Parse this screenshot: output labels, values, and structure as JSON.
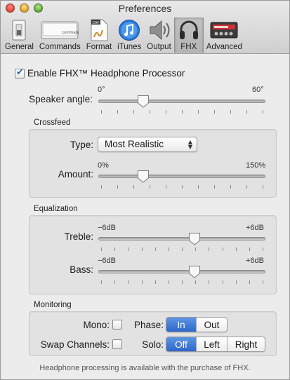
{
  "window": {
    "title": "Preferences"
  },
  "toolbar": {
    "items": [
      {
        "label": "General",
        "icon": "general-switch-icon"
      },
      {
        "label": "Commands",
        "icon": "command-key-icon"
      },
      {
        "label": "Format",
        "icon": "caf-document-icon"
      },
      {
        "label": "iTunes",
        "icon": "itunes-note-icon"
      },
      {
        "label": "Output",
        "icon": "speaker-icon"
      },
      {
        "label": "FHX",
        "icon": "headphones-icon",
        "selected": true
      },
      {
        "label": "Advanced",
        "icon": "audio-device-icon"
      }
    ]
  },
  "enable": {
    "label": "Enable FHX™ Headphone Processor",
    "checked": true
  },
  "speaker_angle": {
    "label": "Speaker angle:",
    "min_label": "0°",
    "max_label": "60°",
    "value_fraction": 0.26
  },
  "crossfeed": {
    "title": "Crossfeed",
    "type_label": "Type:",
    "type_value": "Most Realistic",
    "amount_label": "Amount:",
    "amount_min_label": "0%",
    "amount_max_label": "150%",
    "amount_fraction": 0.26
  },
  "equalization": {
    "title": "Equalization",
    "treble_label": "Treble:",
    "bass_label": "Bass:",
    "min_label": "−6dB",
    "max_label": "+6dB",
    "treble_fraction": 0.58,
    "bass_fraction": 0.58
  },
  "monitoring": {
    "title": "Monitoring",
    "mono_label": "Mono:",
    "mono_checked": false,
    "swap_label": "Swap Channels:",
    "swap_checked": false,
    "phase_label": "Phase:",
    "phase_options": [
      "In",
      "Out"
    ],
    "phase_selected": "In",
    "solo_label": "Solo:",
    "solo_options": [
      "Off",
      "Left",
      "Right"
    ],
    "solo_selected": "Off"
  },
  "footer": {
    "text": "Headphone processing is available with the purchase of FHX."
  },
  "colors": {
    "accent": "#2d67c9"
  }
}
